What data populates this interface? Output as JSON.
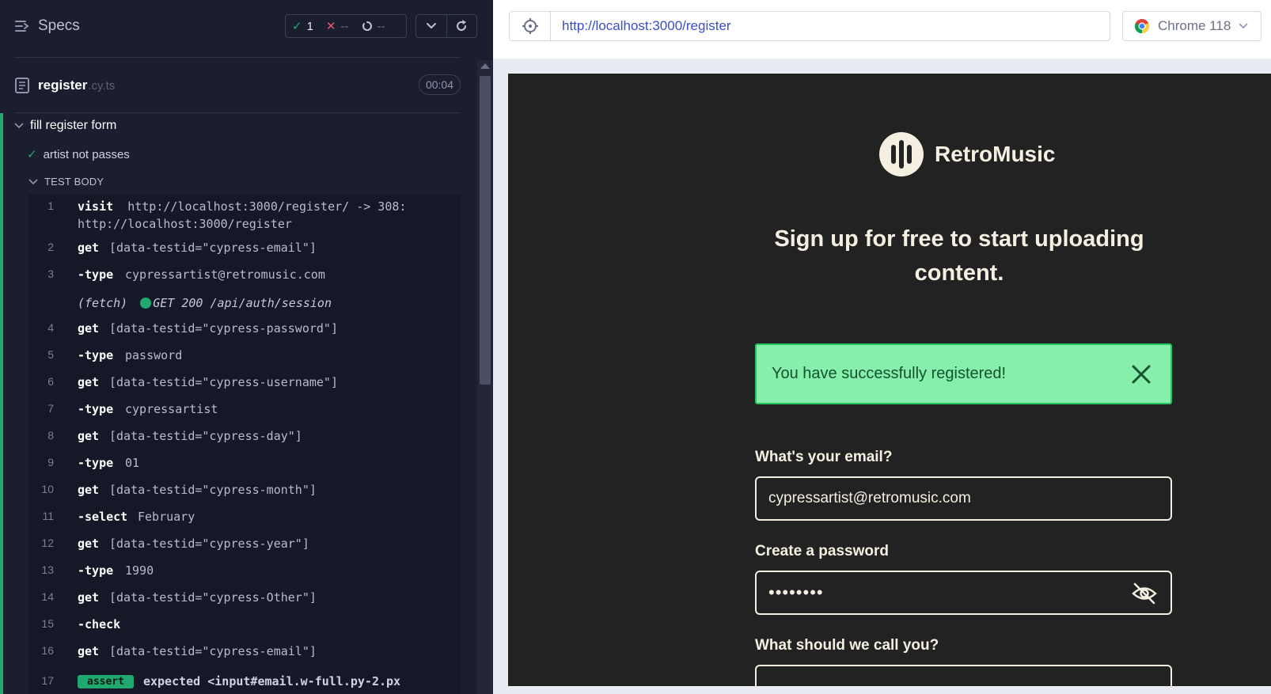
{
  "reporter": {
    "specs_label": "Specs",
    "stats": {
      "passed": "1",
      "failed": "--",
      "pending": "--"
    },
    "spec": {
      "name": "register",
      "ext": ".cy.ts",
      "duration": "00:04"
    },
    "suite_title": "fill register form",
    "test_title": "artist not passes",
    "test_body_label": "TEST BODY",
    "commands": [
      {
        "num": "1",
        "name": "visit",
        "message": "http://localhost:3000/register/ -> 308:",
        "message2": "http://localhost:3000/register"
      },
      {
        "num": "2",
        "name": "get",
        "message": "[data-testid=\"cypress-email\"]"
      },
      {
        "num": "3",
        "name": "-type",
        "message": "cypressartist@retromusic.com"
      },
      {
        "num": "",
        "name": "(fetch)",
        "message": "GET 200 /api/auth/session"
      },
      {
        "num": "4",
        "name": "get",
        "message": "[data-testid=\"cypress-password\"]"
      },
      {
        "num": "5",
        "name": "-type",
        "message": "password"
      },
      {
        "num": "6",
        "name": "get",
        "message": "[data-testid=\"cypress-username\"]"
      },
      {
        "num": "7",
        "name": "-type",
        "message": "cypressartist"
      },
      {
        "num": "8",
        "name": "get",
        "message": "[data-testid=\"cypress-day\"]"
      },
      {
        "num": "9",
        "name": "-type",
        "message": "01"
      },
      {
        "num": "10",
        "name": "get",
        "message": "[data-testid=\"cypress-month\"]"
      },
      {
        "num": "11",
        "name": "-select",
        "message": "February"
      },
      {
        "num": "12",
        "name": "get",
        "message": "[data-testid=\"cypress-year\"]"
      },
      {
        "num": "13",
        "name": "-type",
        "message": "1990"
      },
      {
        "num": "14",
        "name": "get",
        "message": "[data-testid=\"cypress-Other\"]"
      },
      {
        "num": "15",
        "name": "-check",
        "message": ""
      },
      {
        "num": "16",
        "name": "get",
        "message": "[data-testid=\"cypress-email\"]"
      }
    ],
    "partial_row": {
      "num": "17",
      "badge": "assert",
      "text": "expected <input#email.w-full.py-2.px"
    }
  },
  "aut": {
    "url": "http://localhost:3000/register",
    "browser": "Chrome 118",
    "brand": "RetroMusic",
    "headline": "Sign up for free to start uploading content.",
    "alert": "You have successfully registered!",
    "email_label": "What's your email?",
    "email_value": "cypressartist@retromusic.com",
    "password_label": "Create a password",
    "password_value": "••••••••",
    "username_label": "What should we call you?"
  },
  "colors": {
    "reporter_bg": "#1b1e2e",
    "pass": "#1fa971",
    "fail": "#e45770",
    "app_bg": "#222222",
    "app_text": "#f5efe2",
    "alert_bg": "#86efac",
    "url_link": "#3a4ec8"
  }
}
